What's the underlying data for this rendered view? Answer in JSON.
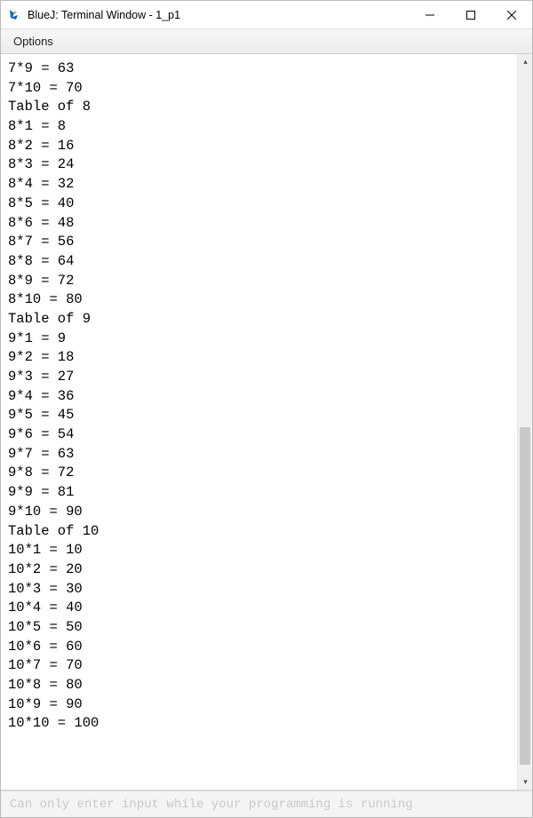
{
  "window": {
    "title": "BlueJ: Terminal Window - 1_p1"
  },
  "menu": {
    "options": "Options"
  },
  "terminal": {
    "lines": [
      "7*9 = 63",
      "7*10 = 70",
      "Table of 8",
      "8*1 = 8",
      "8*2 = 16",
      "8*3 = 24",
      "8*4 = 32",
      "8*5 = 40",
      "8*6 = 48",
      "8*7 = 56",
      "8*8 = 64",
      "8*9 = 72",
      "8*10 = 80",
      "Table of 9",
      "9*1 = 9",
      "9*2 = 18",
      "9*3 = 27",
      "9*4 = 36",
      "9*5 = 45",
      "9*6 = 54",
      "9*7 = 63",
      "9*8 = 72",
      "9*9 = 81",
      "9*10 = 90",
      "Table of 10",
      "10*1 = 10",
      "10*2 = 20",
      "10*3 = 30",
      "10*4 = 40",
      "10*5 = 50",
      "10*6 = 60",
      "10*7 = 70",
      "10*8 = 80",
      "10*9 = 90",
      "10*10 = 100"
    ]
  },
  "input": {
    "placeholder": "Can only enter input while your programming is running"
  }
}
